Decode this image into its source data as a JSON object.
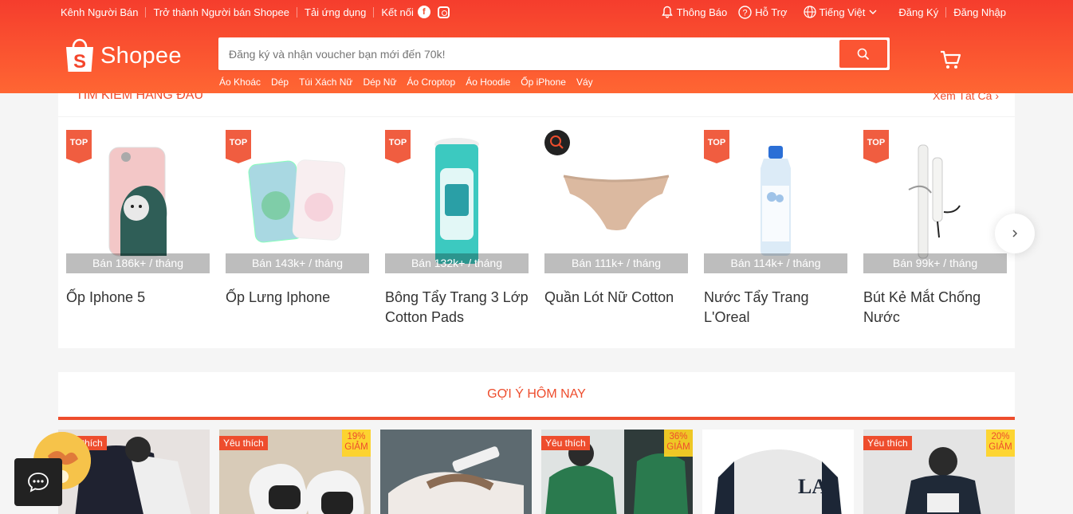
{
  "topbar": {
    "seller_center": "Kênh Người Bán",
    "become_seller": "Trở thành Người bán Shopee",
    "download_app": "Tải ứng dụng",
    "connect": "Kết nối",
    "notifications": "Thông Báo",
    "help": "Hỗ Trợ",
    "language": "Tiếng Việt",
    "register": "Đăng Ký",
    "login": "Đăng Nhập"
  },
  "logo": {
    "text": "Shopee"
  },
  "search": {
    "placeholder": "Đăng ký và nhận voucher bạn mới đến 70k!"
  },
  "suggestions": [
    "Áo Khoác",
    "Dép",
    "Túi Xách Nữ",
    "Dép Nữ",
    "Áo Croptop",
    "Áo Hoodie",
    "Ốp iPhone",
    "Váy"
  ],
  "top_search": {
    "title": "TÌM KIẾM HÀNG ĐẦU",
    "see_all": "Xem Tất Cả",
    "badge": "TOP",
    "products": [
      {
        "name": "Ốp Iphone 5",
        "sold": "Bán 186k+ / tháng"
      },
      {
        "name": "Ốp Lưng Iphone",
        "sold": "Bán 143k+ / tháng"
      },
      {
        "name": "Bông Tẩy Trang 3 Lớp Cotton Pads",
        "sold": "Bán 132k+ / tháng"
      },
      {
        "name": "Quần Lót Nữ Cotton",
        "sold": "Bán 111k+ / tháng"
      },
      {
        "name": "Nước Tẩy Trang L'Oreal",
        "sold": "Bán 114k+ / tháng"
      },
      {
        "name": "Bút Kẻ Mắt Chống Nước",
        "sold": "Bán 99k+ / tháng"
      }
    ]
  },
  "daily_discover": {
    "title": "GỢI Ý HÔM NAY",
    "cards": [
      {
        "fav": "Yêu thích",
        "discount_pct": "",
        "discount_word": ""
      },
      {
        "fav": "Yêu thích",
        "discount_pct": "19%",
        "discount_word": "GIẢM"
      },
      {
        "fav": "",
        "discount_pct": "",
        "discount_word": ""
      },
      {
        "fav": "Yêu thích",
        "discount_pct": "36%",
        "discount_word": "GIẢM"
      },
      {
        "fav": "",
        "discount_pct": "",
        "discount_word": ""
      },
      {
        "fav": "Yêu thích",
        "discount_pct": "20%",
        "discount_word": "GIẢM"
      }
    ]
  },
  "colors": {
    "brand": "#ee4d2d",
    "header_start": "#f53d2d",
    "header_end": "#ff6633"
  }
}
